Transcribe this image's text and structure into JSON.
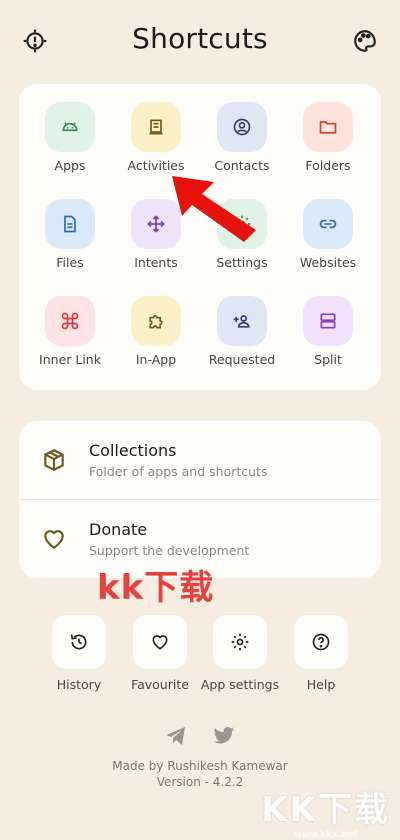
{
  "app": {
    "title": "Shortcuts"
  },
  "grid": [
    {
      "label": "Apps",
      "icon": "android-icon",
      "bg": "#dff3e6",
      "fg": "#2d8a4e"
    },
    {
      "label": "Activities",
      "icon": "activity-icon",
      "bg": "#fbf1c9",
      "fg": "#6b5a1a"
    },
    {
      "label": "Contacts",
      "icon": "contact-icon",
      "bg": "#dfe6f6",
      "fg": "#2f3f66"
    },
    {
      "label": "Folders",
      "icon": "folder-icon",
      "bg": "#fde3dc",
      "fg": "#d13b2a"
    },
    {
      "label": "Files",
      "icon": "file-icon",
      "bg": "#dbeafb",
      "fg": "#2b6cb0"
    },
    {
      "label": "Intents",
      "icon": "move-icon",
      "bg": "#efe2fb",
      "fg": "#7a3fb8"
    },
    {
      "label": "Settings",
      "icon": "gear-icon",
      "bg": "#dff3e6",
      "fg": "#2d8a4e"
    },
    {
      "label": "Websites",
      "icon": "link-icon",
      "bg": "#dbeafb",
      "fg": "#2b6cb0"
    },
    {
      "label": "Inner Link",
      "icon": "command-icon",
      "bg": "#fde3e3",
      "fg": "#d13b3b"
    },
    {
      "label": "In-App",
      "icon": "puzzle-icon",
      "bg": "#fbf1c9",
      "fg": "#6b5a1a"
    },
    {
      "label": "Requested",
      "icon": "person-add-icon",
      "bg": "#dfe6f6",
      "fg": "#2f3f66"
    },
    {
      "label": "Split",
      "icon": "split-icon",
      "bg": "#f3e0fb",
      "fg": "#8a3fb8"
    }
  ],
  "list": [
    {
      "title": "Collections",
      "subtitle": "Folder of apps and shortcuts"
    },
    {
      "title": "Donate",
      "subtitle": "Support the development"
    }
  ],
  "bottom": [
    {
      "label": "History"
    },
    {
      "label": "Favourite"
    },
    {
      "label": "App settings"
    },
    {
      "label": "Help"
    }
  ],
  "footer": {
    "credit": "Made by Rushikesh Kamewar",
    "version": "Version - 4.2.2"
  },
  "overlay": {
    "watermark_mid": "kk下载",
    "watermark_corner": "KK下载",
    "watermark_url": "www.kkx.net"
  },
  "colors": {
    "background": "#f6ecdf",
    "card": "#fffdf9",
    "arrow": "#e8120c"
  }
}
